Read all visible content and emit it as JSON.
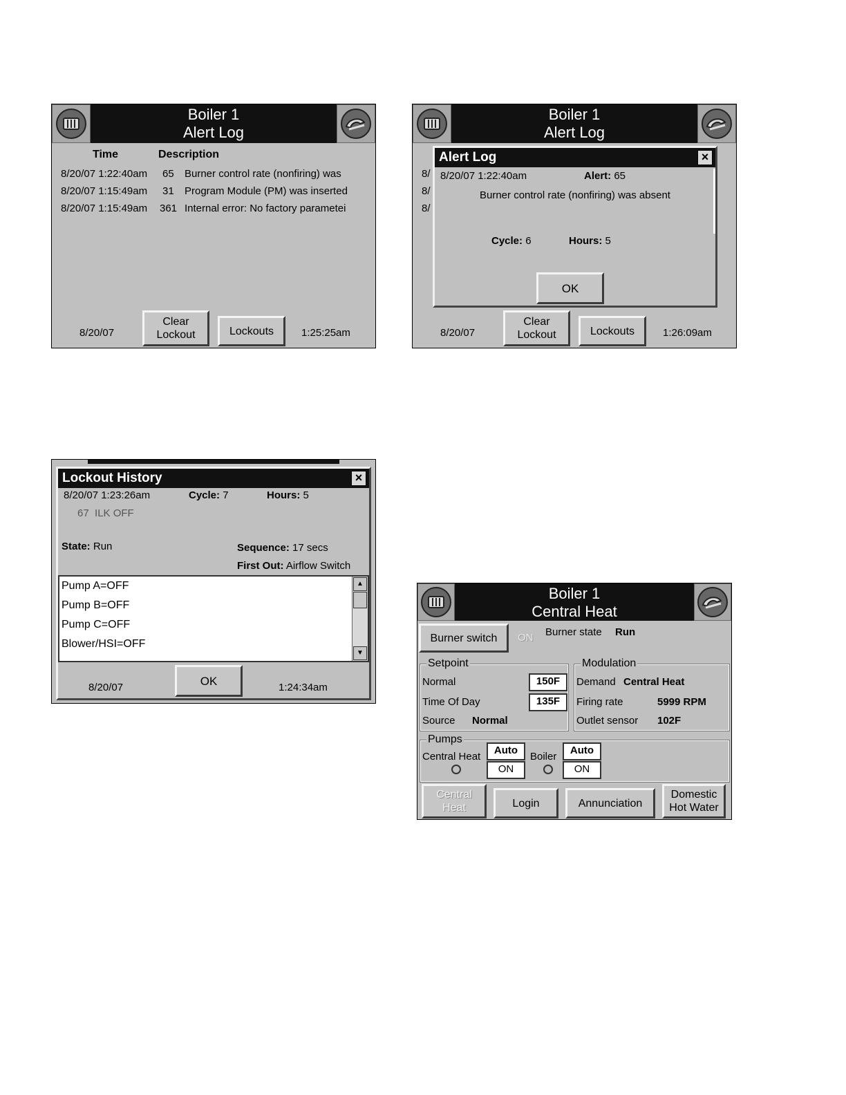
{
  "alert_log_screen": {
    "title_line1": "Boiler 1",
    "title_line2": "Alert Log",
    "columns": {
      "time": "Time",
      "description": "Description"
    },
    "rows": [
      {
        "time": "8/20/07 1:22:40am",
        "code": "65",
        "description": "Burner control rate (nonfiring) was"
      },
      {
        "time": "8/20/07 1:15:49am",
        "code": "31",
        "description": "Program Module (PM) was inserted"
      },
      {
        "time": "8/20/07 1:15:49am",
        "code": "361",
        "description": "Internal error: No factory parametei"
      }
    ],
    "date": "8/20/07",
    "clear_lockout_line1": "Clear",
    "clear_lockout_line2": "Lockout",
    "lockouts_label": "Lockouts",
    "time_now": "1:25:25am"
  },
  "alert_detail_screen": {
    "title_line1": "Boiler 1",
    "title_line2": "Alert Log",
    "bg_row_prefix": "8/",
    "dialog": {
      "title": "Alert Log",
      "close_symbol": "×",
      "timestamp": "8/20/07 1:22:40am",
      "alert_label": "Alert:",
      "alert_value": "65",
      "message": "Burner control rate (nonfiring) was absent",
      "cycle_label": "Cycle:",
      "cycle_value": "6",
      "hours_label": "Hours:",
      "hours_value": "5",
      "ok_label": "OK"
    },
    "date": "8/20/07",
    "clear_lockout_line1": "Clear",
    "clear_lockout_line2": "Lockout",
    "lockouts_label": "Lockouts",
    "time_now": "1:26:09am"
  },
  "lockout_history_screen": {
    "dialog": {
      "title": "Lockout History",
      "close_symbol": "×",
      "timestamp": "8/20/07 1:23:26am",
      "cycle_label": "Cycle:",
      "cycle_value": "7",
      "hours_label": "Hours:",
      "hours_value": "5",
      "lockout_code": "67",
      "lockout_text": "ILK OFF",
      "state_label": "State:",
      "state_value": "Run",
      "sequence_label": "Sequence:",
      "sequence_value": "17 secs",
      "first_out_label": "First Out:",
      "first_out_value": "Airflow Switch",
      "list_items": [
        "Pump A=OFF",
        "Pump B=OFF",
        "Pump C=OFF",
        "Blower/HSI=OFF"
      ],
      "date": "8/20/07",
      "ok_label": "OK",
      "time_now": "1:24:34am"
    }
  },
  "central_heat_screen": {
    "title_line1": "Boiler 1",
    "title_line2": "Central Heat",
    "burner_switch_label": "Burner switch",
    "burner_switch_state": "ON",
    "burner_state_label": "Burner state",
    "burner_state_value": "Run",
    "setpoint": {
      "label": "Setpoint",
      "normal_label": "Normal",
      "normal_value": "150F",
      "tod_label": "Time Of Day",
      "tod_value": "135F",
      "source_label": "Source",
      "source_value": "Normal"
    },
    "modulation": {
      "label": "Modulation",
      "demand_label": "Demand",
      "demand_value": "Central Heat",
      "firing_rate_label": "Firing rate",
      "firing_rate_value": "5999 RPM",
      "outlet_label": "Outlet sensor",
      "outlet_value": "102F"
    },
    "pumps": {
      "label": "Pumps",
      "central_heat_label": "Central Heat",
      "central_heat_mode": "Auto",
      "central_heat_state": "ON",
      "boiler_label": "Boiler",
      "boiler_mode": "Auto",
      "boiler_state": "ON"
    },
    "nav": {
      "central_heat_line1": "Central",
      "central_heat_line2": "Heat",
      "login": "Login",
      "annunciation": "Annunciation",
      "dhw_line1": "Domestic",
      "dhw_line2": "Hot Water"
    }
  },
  "colors": {
    "screen_bg": "#c0c0c0",
    "titlebar_bg": "#111111",
    "title_text": "#ffffff"
  },
  "icons": {
    "left": "boiler-home-icon",
    "right": "configure-icon"
  }
}
